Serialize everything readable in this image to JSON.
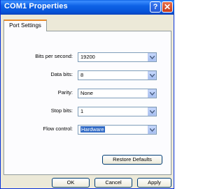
{
  "window": {
    "title": "COM1 Properties",
    "help_glyph": "?",
    "close_glyph": "✕"
  },
  "tabs": [
    {
      "label": "Port Settings"
    }
  ],
  "fields": [
    {
      "id": "bits",
      "label": "Bits per second:",
      "value": "19200"
    },
    {
      "id": "data",
      "label": "Data bits:",
      "value": "8"
    },
    {
      "id": "parity",
      "label": "Parity:",
      "value": "None"
    },
    {
      "id": "stop",
      "label": "Stop bits:",
      "value": "1"
    },
    {
      "id": "flow",
      "label": "Flow control:",
      "value": "Hardware",
      "selected": true
    }
  ],
  "buttons": {
    "restore": "Restore Defaults",
    "ok": "OK",
    "cancel": "Cancel",
    "apply": "Apply"
  },
  "colors": {
    "titlebar": "#0a5fe0",
    "selection": "#316ac5",
    "face": "#ece9d8",
    "tab_accent": "#e68b2c"
  }
}
